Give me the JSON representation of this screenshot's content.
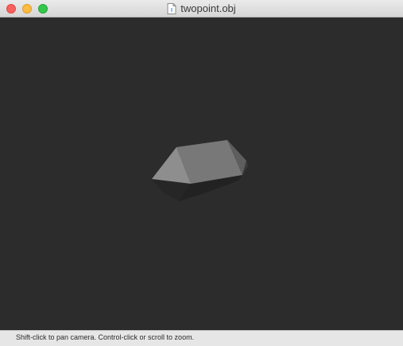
{
  "window": {
    "title": "twopoint.obj",
    "file_icon": "document-icon"
  },
  "traffic_lights": {
    "close_color": "#fc605c",
    "minimize_color": "#fdbc40",
    "zoom_color": "#34c84a"
  },
  "viewport": {
    "background": "#2c2c2c",
    "object": "3d-mesh"
  },
  "status": {
    "hint": "Shift-click to pan camera. Control-click or scroll to zoom."
  }
}
